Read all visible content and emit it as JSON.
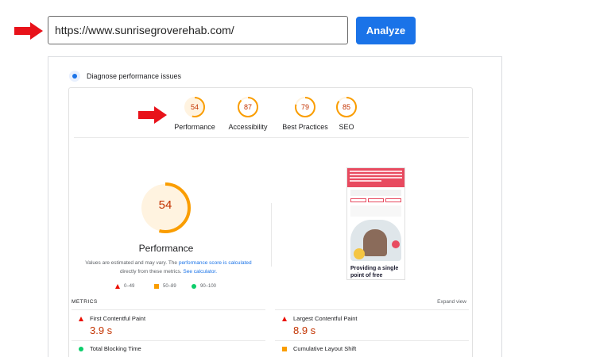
{
  "url_bar": {
    "value": "https://www.sunrisegroverehab.com/",
    "analyze_label": "Analyze"
  },
  "annotations": {
    "arrow_color": "#e8121a",
    "arrow_icon": "red-arrow-icon"
  },
  "panel": {
    "heading": "Diagnose performance issues"
  },
  "scores": [
    {
      "label": "Performance",
      "score": "54",
      "value": 54
    },
    {
      "label": "Accessibility",
      "score": "87",
      "value": 87
    },
    {
      "label": "Best Practices",
      "score": "79",
      "value": 79
    },
    {
      "label": "SEO",
      "score": "85",
      "value": 85
    }
  ],
  "colors": {
    "average": "#fa9d00",
    "average_text": "#c33300",
    "average_fill": "#fff3e0",
    "poor": "#eb0f00",
    "good": "#0cce6b",
    "link": "#1a73e8",
    "button": "#1a73e8"
  },
  "main_score": {
    "score": "54",
    "value": 54,
    "title": "Performance"
  },
  "note": {
    "text1": "Values are estimated and may vary. The ",
    "link1": "performance score is calculated",
    "text2": " directly from these metrics. ",
    "link2": "See calculator."
  },
  "legend": [
    {
      "icon": "red-triangle-icon",
      "label": "0–49"
    },
    {
      "icon": "orange-square-icon",
      "label": "50–89"
    },
    {
      "icon": "green-circle-icon",
      "label": "90–100"
    }
  ],
  "screenshot": {
    "caption": "Providing a single point of free"
  },
  "metrics": {
    "title": "METRICS",
    "expand_label": "Expand view",
    "items": [
      {
        "label": "First Contentful Paint",
        "value": "3.9 s",
        "status": "poor"
      },
      {
        "label": "Largest Contentful Paint",
        "value": "8.9 s",
        "status": "poor"
      },
      {
        "label": "Total Blocking Time",
        "value": "",
        "status": "good"
      },
      {
        "label": "Cumulative Layout Shift",
        "value": "",
        "status": "average"
      }
    ]
  }
}
